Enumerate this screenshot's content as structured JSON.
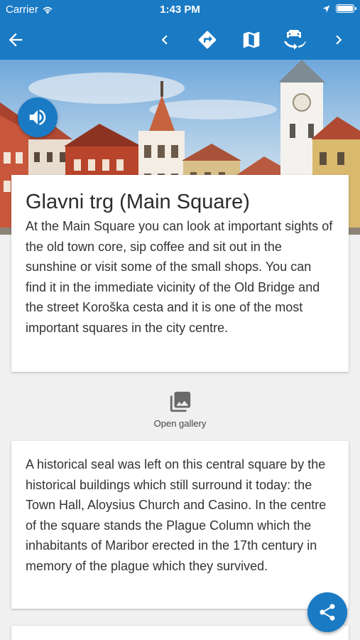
{
  "status_bar": {
    "carrier": "Carrier",
    "time": "1:43 PM"
  },
  "nav": {
    "back_icon": "arrow-left-icon",
    "prev_icon": "chevron-left-icon",
    "directions_icon": "directions-icon",
    "map_icon": "map-icon",
    "car_swap_icon": "car-swap-icon",
    "next_icon": "chevron-right-icon"
  },
  "main_card": {
    "title": "Glavni trg (Main Square)",
    "body": "At the Main Square you can look at important sights of the old town core, sip coffee and sit out in the sunshine or visit some of the small shops. You can find it in the immediate vicinity of the Old Bridge and the street Koroška cesta and it is one of the most important squares in the city centre."
  },
  "gallery": {
    "label": "Open gallery"
  },
  "second_card": {
    "body": "A historical seal was left on this central square by the historical buildings which still surround it today: the Town Hall, Aloysius Church and Casino. In the centre of the square stands the Plague Column which the inhabitants of Maribor erected in the 17th century in memory of the plague which they survived."
  },
  "colors": {
    "primary": "#1a7ac4",
    "background": "#f0f0f0"
  }
}
